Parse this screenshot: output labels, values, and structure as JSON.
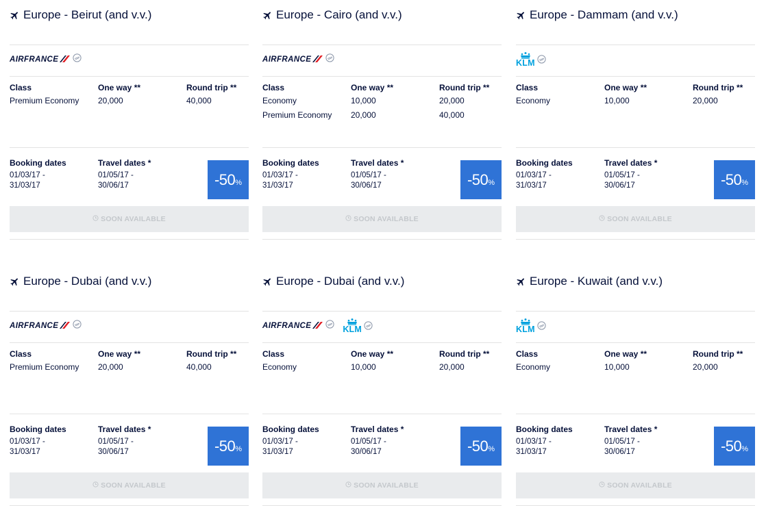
{
  "colors": {
    "navy": "#051039",
    "badge_blue": "#2f73d6",
    "klm_blue": "#00a1de",
    "af_red": "#e11b22",
    "button_bg": "#e9ebed",
    "button_text": "#c4c8cc"
  },
  "labels": {
    "class": "Class",
    "one_way": "One way **",
    "round_trip": "Round trip **",
    "booking_dates": "Booking dates",
    "travel_dates": "Travel dates *",
    "discount": "-50",
    "percent": "%",
    "soon_available": "SOON AVAILABLE"
  },
  "brands": {
    "airfrance": "AIRFRANCE",
    "klm": "KLM"
  },
  "offers": [
    {
      "title": "Europe - Beirut (and v.v.)",
      "airlines": [
        "airfrance"
      ],
      "rows": [
        {
          "class": "Premium Economy",
          "one_way": "20,000",
          "round_trip": "40,000"
        }
      ],
      "booking_from": "01/03/17 -",
      "booking_to": "31/03/17",
      "travel_from": "01/05/17 -",
      "travel_to": "30/06/17"
    },
    {
      "title": "Europe - Cairo (and v.v.)",
      "airlines": [
        "airfrance"
      ],
      "rows": [
        {
          "class": "Economy",
          "one_way": "10,000",
          "round_trip": "20,000"
        },
        {
          "class": "Premium Economy",
          "one_way": "20,000",
          "round_trip": "40,000"
        }
      ],
      "booking_from": "01/03/17 -",
      "booking_to": "31/03/17",
      "travel_from": "01/05/17 -",
      "travel_to": "30/06/17"
    },
    {
      "title": "Europe - Dammam (and v.v.)",
      "airlines": [
        "klm"
      ],
      "rows": [
        {
          "class": "Economy",
          "one_way": "10,000",
          "round_trip": "20,000"
        }
      ],
      "booking_from": "01/03/17 -",
      "booking_to": "31/03/17",
      "travel_from": "01/05/17 -",
      "travel_to": "30/06/17"
    },
    {
      "title": "Europe - Dubai (and v.v.)",
      "airlines": [
        "airfrance"
      ],
      "rows": [
        {
          "class": "Premium Economy",
          "one_way": "20,000",
          "round_trip": "40,000"
        }
      ],
      "booking_from": "01/03/17 -",
      "booking_to": "31/03/17",
      "travel_from": "01/05/17 -",
      "travel_to": "30/06/17"
    },
    {
      "title": "Europe - Dubai (and v.v.)",
      "airlines": [
        "airfrance",
        "klm"
      ],
      "rows": [
        {
          "class": "Economy",
          "one_way": "10,000",
          "round_trip": "20,000"
        }
      ],
      "booking_from": "01/03/17 -",
      "booking_to": "31/03/17",
      "travel_from": "01/05/17 -",
      "travel_to": "30/06/17"
    },
    {
      "title": "Europe - Kuwait (and v.v.)",
      "airlines": [
        "klm"
      ],
      "rows": [
        {
          "class": "Economy",
          "one_way": "10,000",
          "round_trip": "20,000"
        }
      ],
      "booking_from": "01/03/17 -",
      "booking_to": "31/03/17",
      "travel_from": "01/05/17 -",
      "travel_to": "30/06/17"
    }
  ]
}
